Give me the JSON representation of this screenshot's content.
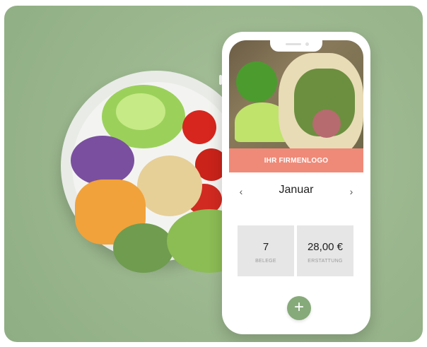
{
  "brand_bar": {
    "label": "IHR FIRMENLOGO"
  },
  "month_selector": {
    "month": "Januar",
    "prev_icon": "chevron-left-icon",
    "next_icon": "chevron-right-icon",
    "prev_glyph": "‹",
    "next_glyph": "›"
  },
  "stats": [
    {
      "value": "7",
      "label": "BELEGE"
    },
    {
      "value": "28,00 €",
      "label": "ERSTATTUNG"
    }
  ],
  "fab": {
    "icon": "plus-icon",
    "glyph": "+"
  },
  "colors": {
    "background_green": "#9cb98f",
    "brand_bar": "#ef8a78",
    "fab_green": "#86aa79",
    "stat_tile": "#e6e6e6"
  }
}
